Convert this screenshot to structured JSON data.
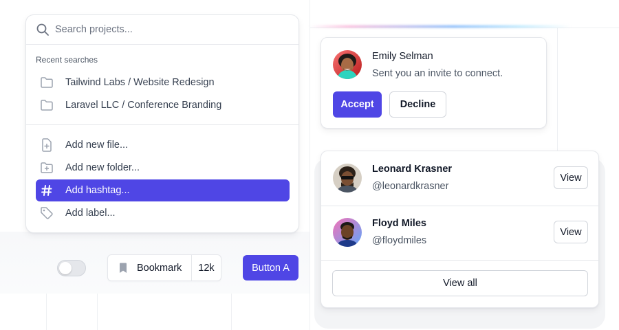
{
  "palette": {
    "search_placeholder": "Search projects...",
    "recent_label": "Recent searches",
    "recent": [
      {
        "label": "Tailwind Labs / Website Redesign",
        "icon": "folder-icon"
      },
      {
        "label": "Laravel LLC / Conference Branding",
        "icon": "folder-icon"
      }
    ],
    "actions": [
      {
        "label": "Add new file...",
        "icon": "file-plus-icon"
      },
      {
        "label": "Add new folder...",
        "icon": "folder-plus-icon"
      },
      {
        "label": "Add hashtag...",
        "icon": "hashtag-icon",
        "active": true
      },
      {
        "label": "Add label...",
        "icon": "tag-icon"
      }
    ]
  },
  "controls": {
    "toggle_on": false,
    "bookmark_label": "Bookmark",
    "bookmark_count": "12k",
    "button_a": "Button A"
  },
  "invite": {
    "name": "Emily Selman",
    "message": "Sent you an invite to connect.",
    "accept": "Accept",
    "decline": "Decline"
  },
  "users": {
    "items": [
      {
        "name": "Leonard Krasner",
        "handle": "@leonardkrasner",
        "action": "View"
      },
      {
        "name": "Floyd Miles",
        "handle": "@floydmiles",
        "action": "View"
      }
    ],
    "view_all": "View all"
  },
  "colors": {
    "accent": "#4f46e5",
    "border": "#e5e7eb",
    "muted_text": "#4b5563"
  }
}
